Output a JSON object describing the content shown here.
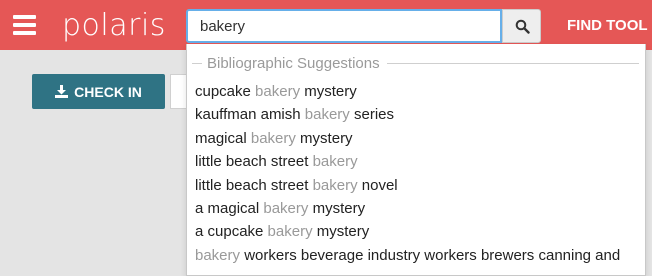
{
  "header": {
    "brand": "polaris",
    "find_tool_label": "FIND TOOL",
    "colors": {
      "bar": "#e55756",
      "text": "#ffffff"
    }
  },
  "search": {
    "value": "bakery",
    "button_icon": "search-icon"
  },
  "main": {
    "checkin_label": "CHECK IN",
    "checkin_icon": "download-icon",
    "checkin_color": "#2f7384"
  },
  "suggestions": {
    "title": "Bibliographic Suggestions",
    "items": [
      {
        "before": "cupcake ",
        "match": "bakery",
        "after": " mystery"
      },
      {
        "before": "kauffman amish ",
        "match": "bakery",
        "after": " series"
      },
      {
        "before": "magical ",
        "match": "bakery",
        "after": " mystery"
      },
      {
        "before": "little beach street ",
        "match": "bakery",
        "after": ""
      },
      {
        "before": "little beach street ",
        "match": "bakery",
        "after": " novel"
      },
      {
        "before": "a magical ",
        "match": "bakery",
        "after": " mystery"
      },
      {
        "before": "a cupcake ",
        "match": "bakery",
        "after": " mystery"
      },
      {
        "before": "",
        "match": "bakery",
        "after": " workers beverage industry workers brewers canning and"
      }
    ]
  }
}
